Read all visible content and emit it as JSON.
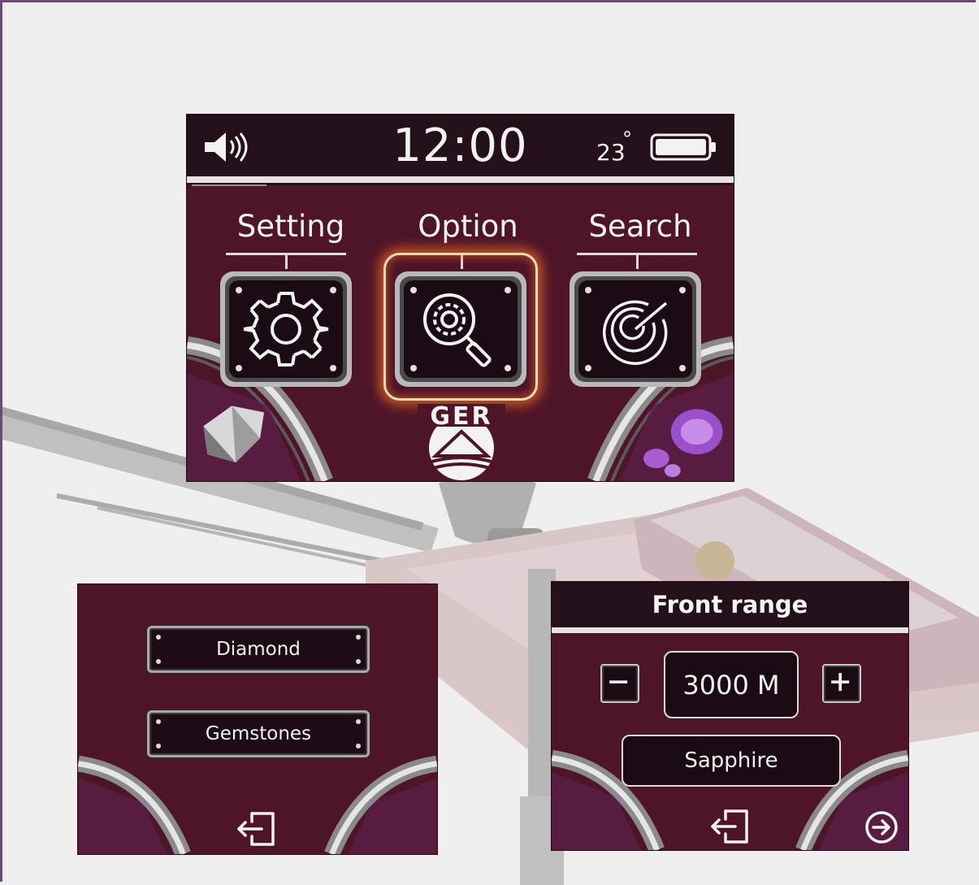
{
  "main_screen": {
    "time": "12:00",
    "temperature": "23",
    "temperature_unit": "°",
    "sound_icon": "speaker-volume-icon",
    "battery_icon": "battery-icon",
    "menu": [
      {
        "label": "Setting",
        "icon": "gear-icon",
        "selected": false
      },
      {
        "label": "Option",
        "icon": "gear-search-icon",
        "selected": true
      },
      {
        "label": "Search",
        "icon": "radar-icon",
        "selected": false
      }
    ],
    "logo_text": "GER"
  },
  "gem_screen": {
    "buttons": [
      {
        "label": "Diamond"
      },
      {
        "label": "Gemstones"
      }
    ],
    "exit_icon": "exit-icon"
  },
  "range_screen": {
    "title": "Front range",
    "value": "3000 M",
    "decrease_icon": "minus-icon",
    "increase_icon": "plus-icon",
    "material": "Sapphire",
    "exit_icon": "exit-icon",
    "next_icon": "arrow-right-circle-icon"
  },
  "colors": {
    "screen_bg": "#4e1428",
    "bar_bg": "#241018",
    "highlight_glow": "#ff7828",
    "highlight_ring": "#f4ddb0"
  }
}
